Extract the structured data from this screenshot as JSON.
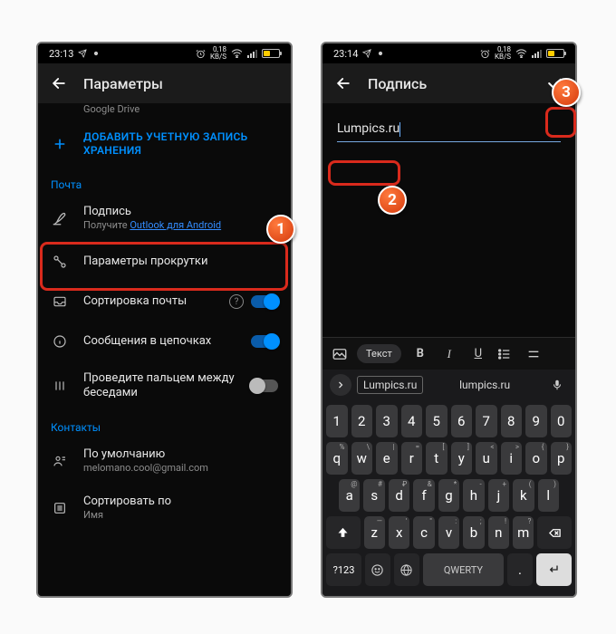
{
  "status": {
    "time_left": "23:13",
    "time_right": "23:14",
    "net": "0,18",
    "net_unit": "KB/S"
  },
  "left": {
    "header_title": "Параметры",
    "prev_item_sub": "Google Drive",
    "add_account": "ДОБАВИТЬ УЧЕТНУЮ ЗАПИСЬ ХРАНЕНИЯ",
    "section_mail": "Почта",
    "signature": {
      "label": "Подпись",
      "sub_prefix": "Получите ",
      "sub_link": "Outlook для Android"
    },
    "scroll": "Параметры прокрутки",
    "sort": "Сортировка почты",
    "threads": "Сообщения в цепочках",
    "swipe": {
      "label": "Проведите пальцем между",
      "sub": "беседами"
    },
    "section_contacts": "Контакты",
    "default": {
      "label": "По умолчанию",
      "sub": "melomano.cool@gmail.com"
    },
    "sortby": {
      "label": "Сортировать по",
      "sub": "Имя"
    }
  },
  "right": {
    "header_title": "Подпись",
    "input_value": "Lumpics.ru",
    "toolbar": {
      "chip": "Текст",
      "b": "B",
      "i": "I",
      "u": "U"
    },
    "sugg1": "Lumpics.ru",
    "sugg2": "lumpics.ru",
    "rows": {
      "r1": [
        "1",
        "2",
        "3",
        "4",
        "5",
        "6",
        "7",
        "8",
        "9",
        "0"
      ],
      "r2": [
        "q",
        "w",
        "e",
        "r",
        "t",
        "y",
        "u",
        "i",
        "o",
        "p"
      ],
      "r2s": [
        "%",
        "\\",
        "|",
        "=",
        "[",
        "]",
        "<",
        ">",
        "{",
        "}"
      ],
      "r3": [
        "a",
        "s",
        "d",
        "f",
        "g",
        "h",
        "j",
        "k",
        "l"
      ],
      "r3s": [
        "@",
        "#",
        "₽",
        "&",
        "*",
        "-",
        "+",
        "(",
        ")"
      ],
      "r4": [
        "z",
        "x",
        "c",
        "v",
        "b",
        "n",
        "m"
      ],
      "r4s": [
        "—",
        "'",
        "\"",
        ":",
        ";",
        "!",
        "?"
      ]
    },
    "fn": {
      "sym": "?123",
      "space": "QWERTY",
      "dot": "."
    }
  },
  "steps": {
    "s1": "1",
    "s2": "2",
    "s3": "3"
  }
}
